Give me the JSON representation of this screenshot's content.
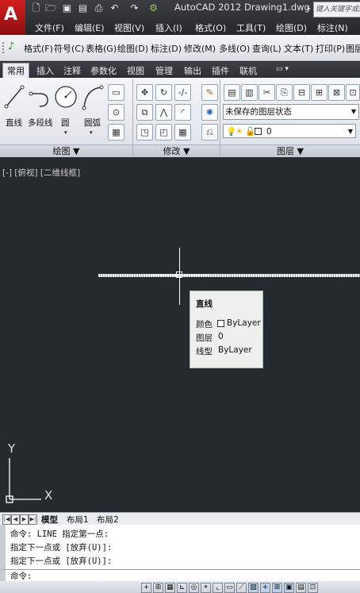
{
  "title": {
    "text": "AutoCAD 2012   Drawing1.dwg",
    "search_placeholder": "键入关键字或短语",
    "app_letter": "A"
  },
  "menu": [
    "文件(F)",
    "编辑(E)",
    "视图(V)",
    "插入(I)",
    "格式(O)",
    "工具(T)",
    "绘图(D)",
    "标注(N)"
  ],
  "toolbar": [
    "格式(F)",
    "符号(C)",
    "表格(G)",
    "绘图(D)",
    "标注(D)",
    "修改(M)",
    "多线(O)",
    "查询(L)",
    "文本(T)",
    "打印(P)",
    "图层"
  ],
  "ribbon_tabs": [
    "常用",
    "插入",
    "注释",
    "参数化",
    "视图",
    "管理",
    "输出",
    "插件",
    "联机"
  ],
  "ribbon": {
    "draw_tools": [
      "直线",
      "多段线",
      "圆",
      "圆弧"
    ],
    "panels": [
      "绘图 ▼",
      "修改 ▼",
      "图层 ▼"
    ],
    "layer_state": "未保存的图层状态",
    "layer_name": "0"
  },
  "viewport_label": "[-] [俯视] [二维线框]",
  "tooltip": {
    "title": "直线",
    "rows": [
      {
        "key": "颜色",
        "value": "ByLayer"
      },
      {
        "key": "图层",
        "value": "0"
      },
      {
        "key": "线型",
        "value": "ByLayer"
      }
    ]
  },
  "ucs": {
    "x": "X",
    "y": "Y"
  },
  "layout_tabs": [
    "模型",
    "布局1",
    "布局2"
  ],
  "command": {
    "lines": [
      "命令:  LINE 指定第一点:",
      "指定下一点或 [放弃(U)]:",
      "指定下一点或 [放弃(U)]:"
    ],
    "prompt": "命令:"
  },
  "colors": {
    "drawing_bg": "#252a2e",
    "accent_red": "#c81818"
  }
}
